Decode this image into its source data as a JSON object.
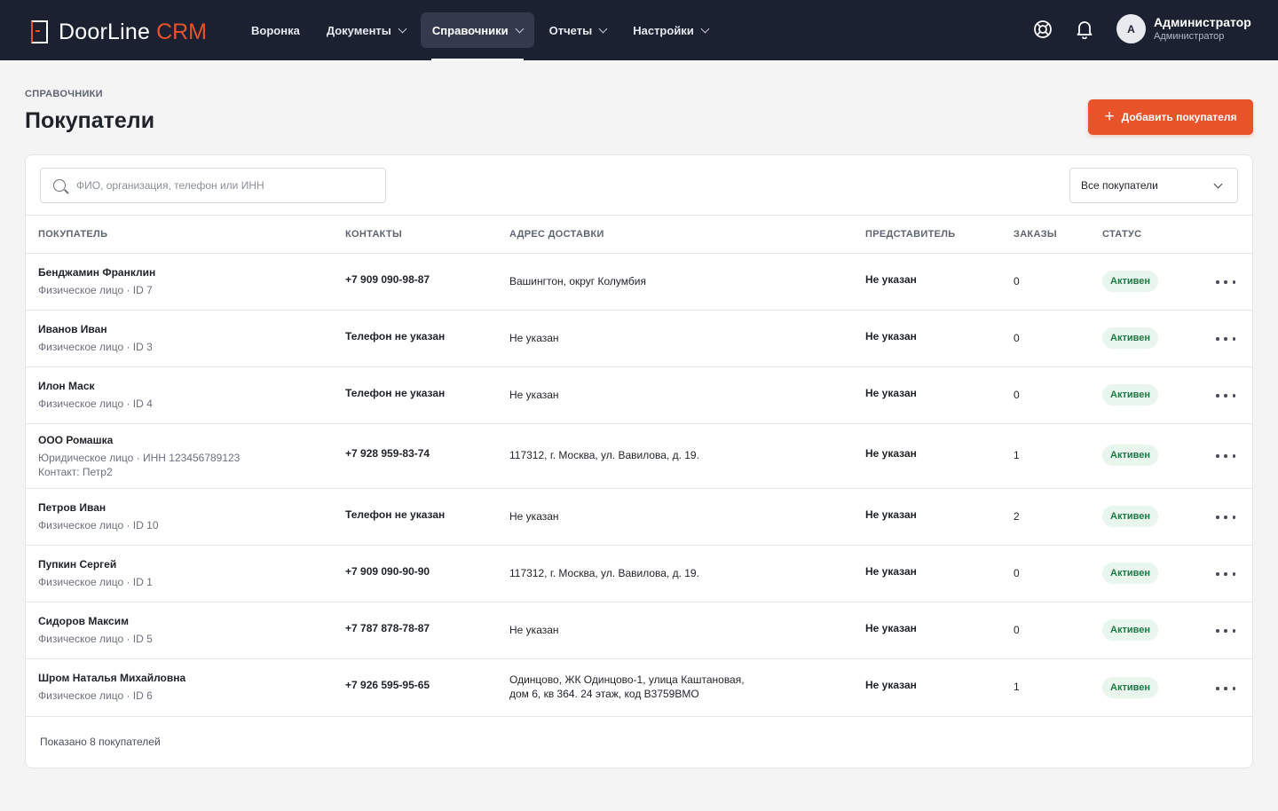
{
  "app": {
    "logo_text": "DoorLine",
    "logo_accent": "CRM",
    "accent_color": "#e8532a",
    "nav_bg": "#1c2132"
  },
  "nav": {
    "items": [
      {
        "label": "Воронка",
        "has_dropdown": false
      },
      {
        "label": "Документы",
        "has_dropdown": true
      },
      {
        "label": "Справочники",
        "has_dropdown": true,
        "active": true
      },
      {
        "label": "Отчеты",
        "has_dropdown": true
      },
      {
        "label": "Настройки",
        "has_dropdown": true
      }
    ]
  },
  "top_icons": [
    "help-lifebuoy-icon",
    "notifications-bell-icon"
  ],
  "user": {
    "avatar_letter": "А",
    "name": "Администратор",
    "role": "Администратор"
  },
  "page": {
    "breadcrumb": "СПРАВОЧНИКИ",
    "title": "Покупатели",
    "add_button": "Добавить покупателя"
  },
  "search": {
    "placeholder": "ФИО, организация, телефон или ИНН",
    "value": ""
  },
  "filter": {
    "selected": "Все покупатели"
  },
  "table": {
    "columns": [
      "ПОКУПАТЕЛЬ",
      "КОНТАКТЫ",
      "АДРЕС ДОСТАВКИ",
      "ПРЕДСТАВИТЕЛЬ",
      "ЗАКАЗЫ",
      "СТАТУС"
    ],
    "rows": [
      {
        "name": "Бенджамин Франклин",
        "sub": "Физическое лицо · ID 7",
        "sub2": "",
        "contact": "+7 909 090-98-87",
        "address": "Вашингтон, округ Колумбия",
        "address2": "",
        "rep": "Не указан",
        "orders": "0",
        "status": "Активен"
      },
      {
        "name": "Иванов Иван",
        "sub": "Физическое лицо · ID 3",
        "sub2": "",
        "contact": "Телефон не указан",
        "address": "Не указан",
        "address2": "",
        "rep": "Не указан",
        "orders": "0",
        "status": "Активен"
      },
      {
        "name": "Илон Маск",
        "sub": "Физическое лицо · ID 4",
        "sub2": "",
        "contact": "Телефон не указан",
        "address": "Не указан",
        "address2": "",
        "rep": "Не указан",
        "orders": "0",
        "status": "Активен"
      },
      {
        "name": "ООО Ромашка",
        "sub": "Юридическое лицо · ИНН 123456789123",
        "sub2": "Контакт: Петр2",
        "contact": "+7 928 959-83-74",
        "address": "117312, г. Москва, ул. Вавилова, д. 19.",
        "address2": "",
        "rep": "Не указан",
        "orders": "1",
        "status": "Активен"
      },
      {
        "name": "Петров Иван",
        "sub": "Физическое лицо · ID 10",
        "sub2": "",
        "contact": "Телефон не указан",
        "address": "Не указан",
        "address2": "",
        "rep": "Не указан",
        "orders": "2",
        "status": "Активен"
      },
      {
        "name": "Пупкин Сергей",
        "sub": "Физическое лицо · ID 1",
        "sub2": "",
        "contact": "+7 909 090-90-90",
        "address": "117312, г. Москва, ул. Вавилова, д. 19.",
        "address2": "",
        "rep": "Не указан",
        "orders": "0",
        "status": "Активен"
      },
      {
        "name": "Сидоров Максим",
        "sub": "Физическое лицо · ID 5",
        "sub2": "",
        "contact": "+7 787 878-78-87",
        "address": "Не указан",
        "address2": "",
        "rep": "Не указан",
        "orders": "0",
        "status": "Активен"
      },
      {
        "name": "Шром Наталья Михайловна",
        "sub": "Физическое лицо · ID 6",
        "sub2": "",
        "contact": "+7 926 595-95-65",
        "address": "Одинцово, ЖК Одинцово-1, улица Каштановая,",
        "address2": "дом 6, кв 364. 24 этаж, код B3759BMO",
        "rep": "Не указан",
        "orders": "1",
        "status": "Активен"
      }
    ]
  },
  "footer": {
    "count_text": "Показано 8 покупателей"
  }
}
